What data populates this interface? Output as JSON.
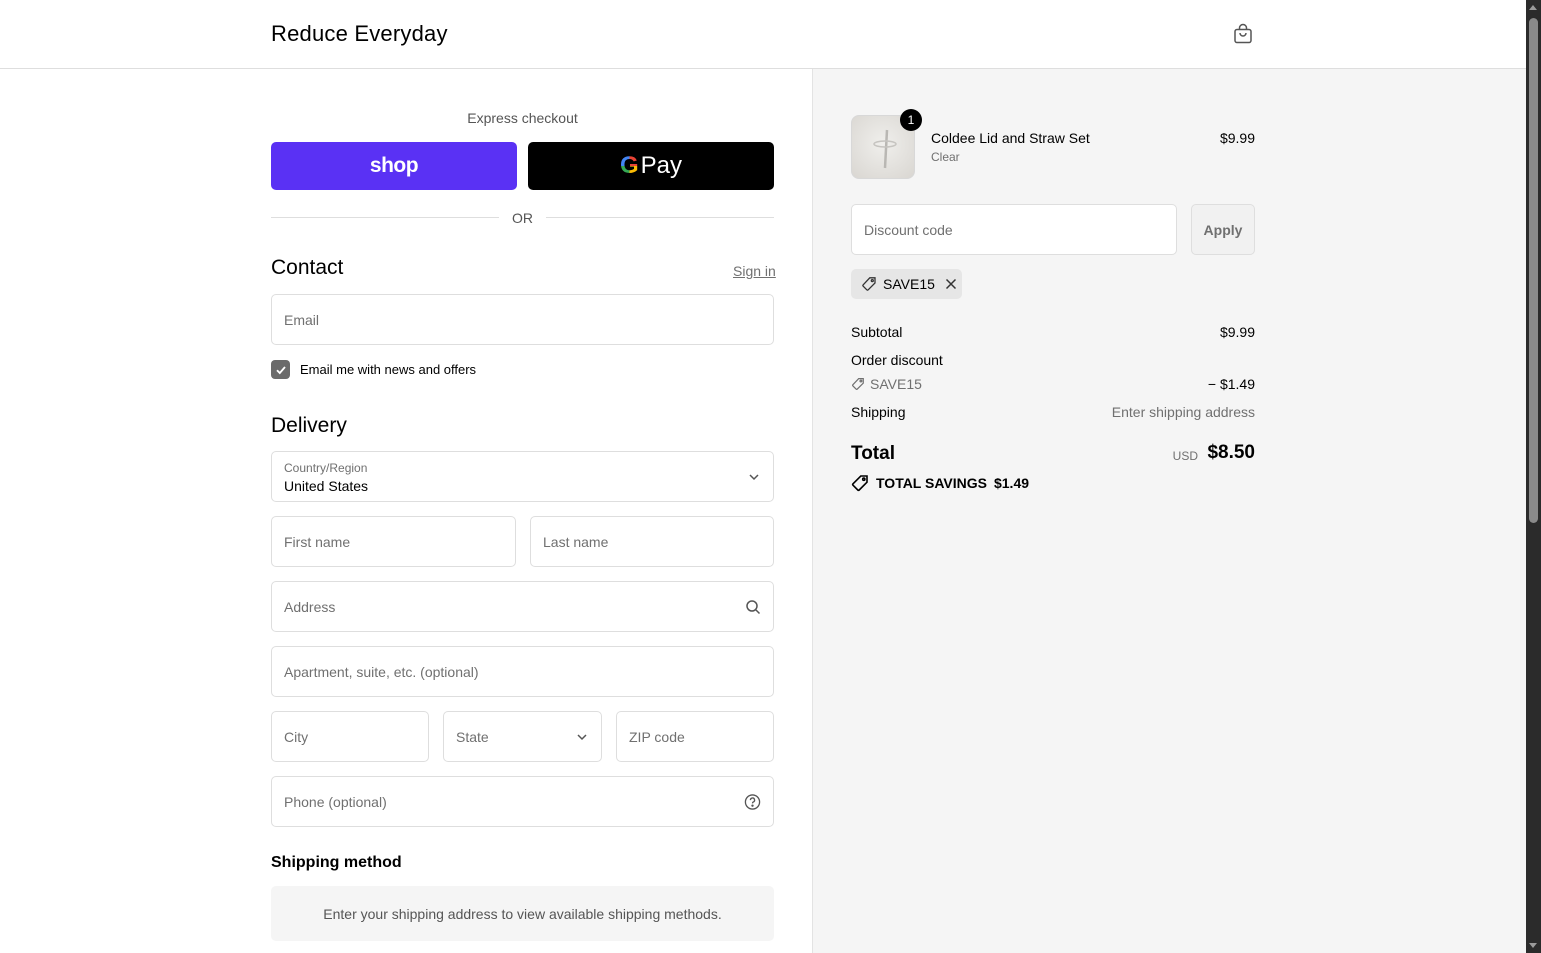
{
  "header": {
    "brand": "Reduce Everyday",
    "cart_icon": "shopping-bag-icon"
  },
  "express": {
    "label": "Express checkout",
    "shop_label": "shop",
    "gpay_g": "G",
    "gpay_label": "Pay",
    "or": "OR"
  },
  "contact": {
    "title": "Contact",
    "signin": "Sign in",
    "email_placeholder": "Email",
    "newsletter_checked": true,
    "newsletter_label": "Email me with news and offers"
  },
  "delivery": {
    "title": "Delivery",
    "country_label": "Country/Region",
    "country_value": "United States",
    "first_name": "First name",
    "last_name": "Last name",
    "address": "Address",
    "apartment": "Apartment, suite, etc. (optional)",
    "city": "City",
    "state": "State",
    "zip": "ZIP code",
    "phone": "Phone (optional)"
  },
  "shipping_method": {
    "title": "Shipping method",
    "message": "Enter your shipping address to view available shipping methods."
  },
  "summary": {
    "item": {
      "quantity": "1",
      "name": "Coldee Lid and Straw Set",
      "variant": "Clear",
      "price": "$9.99"
    },
    "discount_placeholder": "Discount code",
    "apply_label": "Apply",
    "applied_code": "SAVE15",
    "subtotal_label": "Subtotal",
    "subtotal_value": "$9.99",
    "order_discount_label": "Order discount",
    "discount_code": "SAVE15",
    "discount_value": "− $1.49",
    "shipping_label": "Shipping",
    "shipping_value": "Enter shipping address",
    "total_label": "Total",
    "currency": "USD",
    "total_value": "$8.50",
    "savings_label": "TOTAL SAVINGS",
    "savings_value": "$1.49"
  },
  "colors": {
    "shop_purple": "#5a31f4",
    "panel_bg": "#f5f5f5",
    "border": "#dedede"
  }
}
